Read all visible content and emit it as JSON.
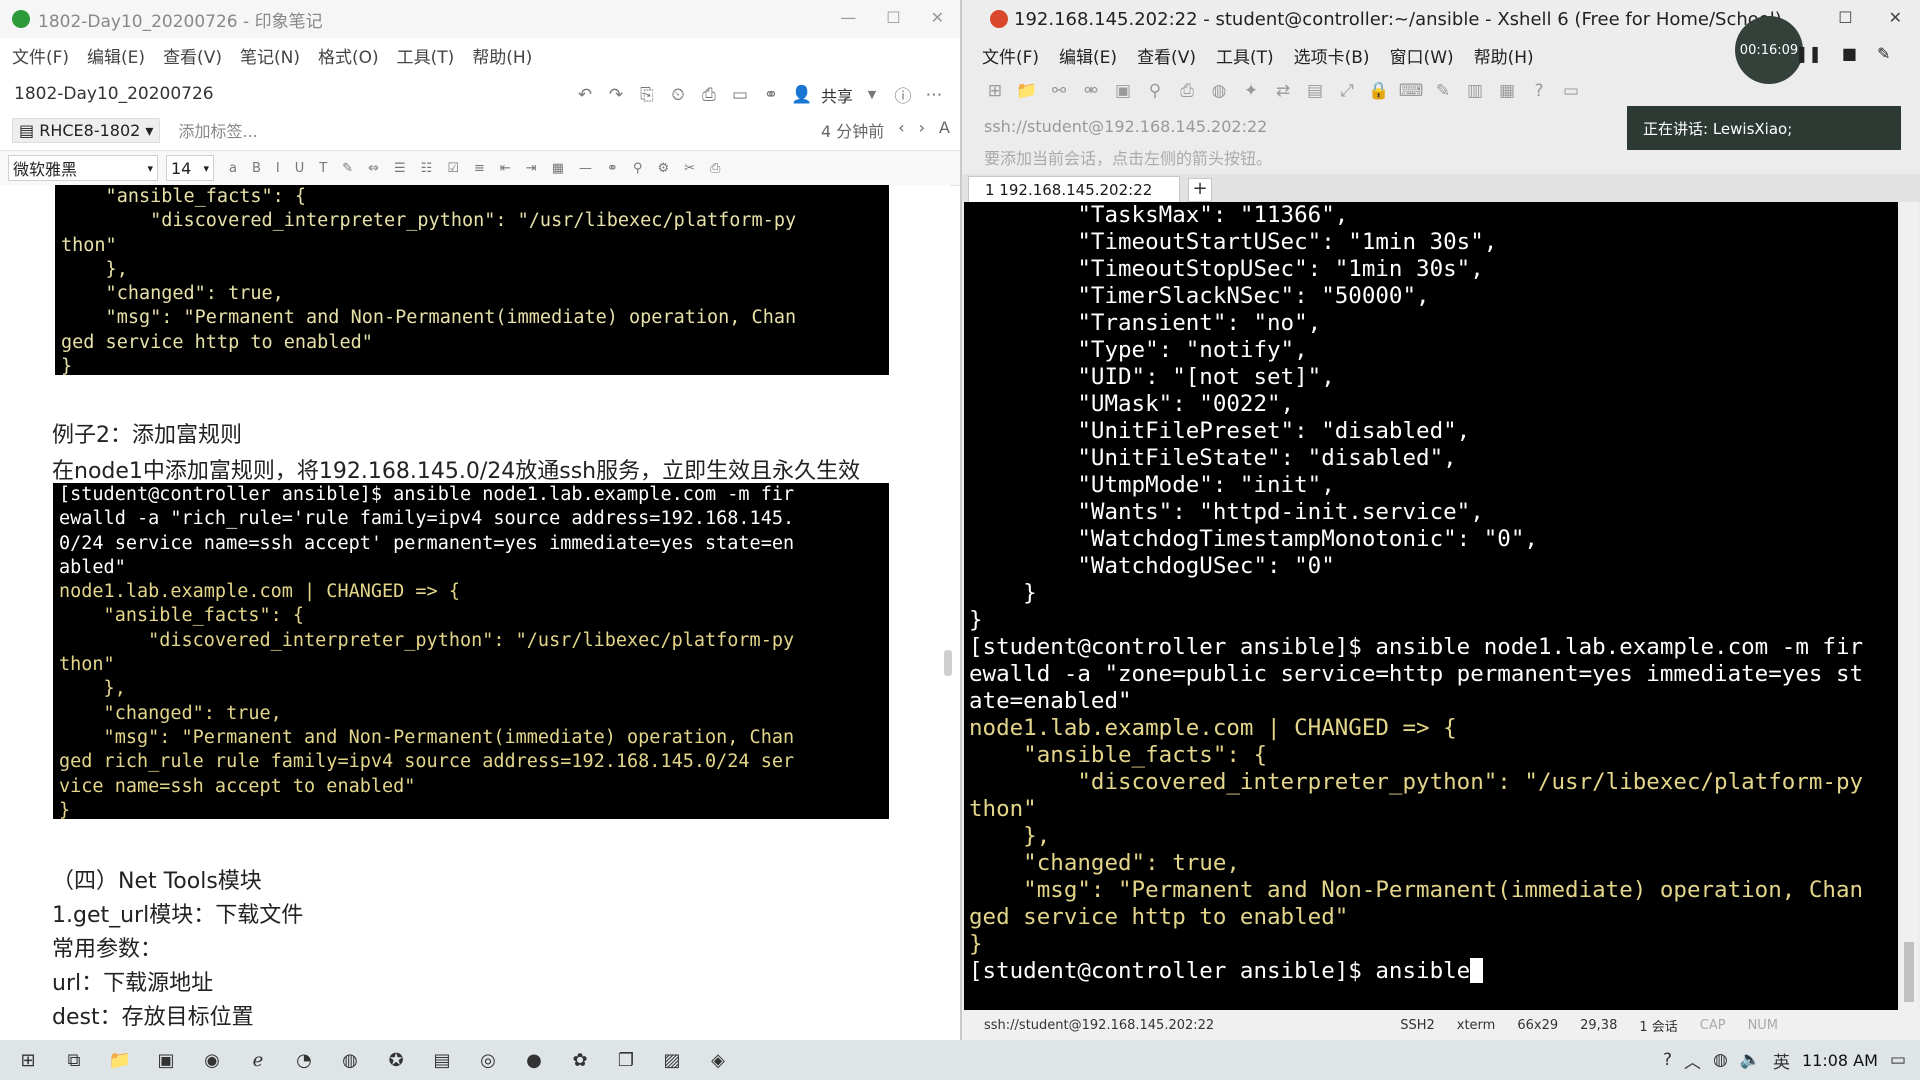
{
  "evernote": {
    "title": "1802-Day10_20200726 - 印象笔记",
    "window_controls": [
      "—",
      "☐",
      "✕"
    ],
    "menu": [
      "文件(F)",
      "编辑(E)",
      "查看(V)",
      "笔记(N)",
      "格式(O)",
      "工具(T)",
      "帮助(H)"
    ],
    "note_title": "1802-Day10_20200726",
    "share_label": "共享",
    "notebook_label": "RHCE8-1802",
    "add_tag_label": "添加标签...",
    "time_ago": "4 分钟前",
    "font_name": "微软雅黑",
    "font_size": "14",
    "format_icons": [
      "a",
      "B",
      "I",
      "U",
      "T",
      "✎",
      "⇔",
      "☰",
      "☷",
      "☑",
      "≡",
      "⇤",
      "⇥",
      "▦",
      "—",
      "⚭",
      "⚲",
      "⚙",
      "✂",
      "⎙"
    ],
    "code_block_1": [
      {
        "text": "    \"ansible_facts\": {",
        "color": "g"
      },
      {
        "text": "        \"discovered_interpreter_python\": \"/usr/libexec/platform-py",
        "color": "g"
      },
      {
        "text": "thon\"",
        "color": "g"
      },
      {
        "text": "    },",
        "color": "g"
      },
      {
        "text": "    \"changed\": true,",
        "color": "g"
      },
      {
        "text": "    \"msg\": \"Permanent and Non-Permanent(immediate) operation, Chan",
        "color": "g"
      },
      {
        "text": "ged service http to enabled\"",
        "color": "g"
      },
      {
        "text": "}",
        "color": "g"
      }
    ],
    "example2_title": "例子2：添加富规则",
    "example2_desc": "在node1中添加富规则，将192.168.145.0/24放通ssh服务，立即生效且永久生效",
    "code_block_2": [
      {
        "text": "[student@controller ansible]$ ansible node1.lab.example.com -m fir",
        "color": "w"
      },
      {
        "text": "ewalld -a \"rich_rule='rule family=ipv4 source address=192.168.145.",
        "color": "w"
      },
      {
        "text": "0/24 service name=ssh accept' permanent=yes immediate=yes state=en",
        "color": "w"
      },
      {
        "text": "abled\"",
        "color": "w"
      },
      {
        "text": "node1.lab.example.com | CHANGED => {",
        "color": "y"
      },
      {
        "text": "    \"ansible_facts\": {",
        "color": "y"
      },
      {
        "text": "        \"discovered_interpreter_python\": \"/usr/libexec/platform-py",
        "color": "y"
      },
      {
        "text": "thon\"",
        "color": "y"
      },
      {
        "text": "    },",
        "color": "y"
      },
      {
        "text": "    \"changed\": true,",
        "color": "y"
      },
      {
        "text": "    \"msg\": \"Permanent and Non-Permanent(immediate) operation, Chan",
        "color": "y"
      },
      {
        "text": "ged rich_rule rule family=ipv4 source address=192.168.145.0/24 ser",
        "color": "y"
      },
      {
        "text": "vice name=ssh accept to enabled\"",
        "color": "y"
      },
      {
        "text": "}",
        "color": "y"
      }
    ],
    "section_title": "（四）Net Tools模块",
    "get_url_title": "1.get_url模块：下载文件",
    "common_params": "常用参数：",
    "param_url": "url：下载源地址",
    "param_dest": "dest：存放目标位置"
  },
  "xshell": {
    "title": "192.168.145.202:22 - student@controller:~/ansible - Xshell 6 (Free for Home/School)",
    "window_controls": [
      "☐",
      "✕"
    ],
    "menu": [
      "文件(F)",
      "编辑(E)",
      "查看(V)",
      "工具(T)",
      "选项卡(B)",
      "窗口(W)",
      "帮助(H)"
    ],
    "address": "ssh://student@192.168.145.202:22",
    "hint": "要添加当前会话，点击左侧的箭头按钮。",
    "tab_label": "1 192.168.145.202:22",
    "tab_add": "+",
    "terminal_lines": [
      {
        "text": "        \"TasksMax\": \"11366\",",
        "color": "w"
      },
      {
        "text": "        \"TimeoutStartUSec\": \"1min 30s\",",
        "color": "w"
      },
      {
        "text": "        \"TimeoutStopUSec\": \"1min 30s\",",
        "color": "w"
      },
      {
        "text": "        \"TimerSlackNSec\": \"50000\",",
        "color": "w"
      },
      {
        "text": "        \"Transient\": \"no\",",
        "color": "w"
      },
      {
        "text": "        \"Type\": \"notify\",",
        "color": "w"
      },
      {
        "text": "        \"UID\": \"[not set]\",",
        "color": "w"
      },
      {
        "text": "        \"UMask\": \"0022\",",
        "color": "w"
      },
      {
        "text": "        \"UnitFilePreset\": \"disabled\",",
        "color": "w"
      },
      {
        "text": "        \"UnitFileState\": \"disabled\",",
        "color": "w"
      },
      {
        "text": "        \"UtmpMode\": \"init\",",
        "color": "w"
      },
      {
        "text": "        \"Wants\": \"httpd-init.service\",",
        "color": "w"
      },
      {
        "text": "        \"WatchdogTimestampMonotonic\": \"0\",",
        "color": "w"
      },
      {
        "text": "        \"WatchdogUSec\": \"0\"",
        "color": "w"
      },
      {
        "text": "    }",
        "color": "w"
      },
      {
        "text": "}",
        "color": "w"
      },
      {
        "text": "[student@controller ansible]$ ansible node1.lab.example.com -m fir",
        "color": "w"
      },
      {
        "text": "ewalld -a \"zone=public service=http permanent=yes immediate=yes st",
        "color": "w"
      },
      {
        "text": "ate=enabled\"",
        "color": "w"
      },
      {
        "text": "node1.lab.example.com | CHANGED => {",
        "color": "y"
      },
      {
        "text": "    \"ansible_facts\": {",
        "color": "y"
      },
      {
        "text": "        \"discovered_interpreter_python\": \"/usr/libexec/platform-py",
        "color": "y"
      },
      {
        "text": "thon\"",
        "color": "y"
      },
      {
        "text": "    },",
        "color": "y"
      },
      {
        "text": "    \"changed\": true,",
        "color": "y"
      },
      {
        "text": "    \"msg\": \"Permanent and Non-Permanent(immediate) operation, Chan",
        "color": "y"
      },
      {
        "text": "ged service http to enabled\"",
        "color": "y"
      },
      {
        "text": "}",
        "color": "y"
      }
    ],
    "prompt_line": "[student@controller ansible]$ ansible",
    "status": {
      "address": "ssh://student@192.168.145.202:22",
      "protocol": "SSH2",
      "terminal": "xterm",
      "size": "66x29",
      "position": "29,38",
      "sessions": "1 会话",
      "caps": "CAP",
      "num": "NUM"
    }
  },
  "recording": {
    "timer": "00:16:09",
    "speaker": "正在讲话: LewisXiao;"
  },
  "taskbar": {
    "clock": "11:08 AM",
    "ime": "英"
  },
  "colors": {
    "terminal_bg": "#000000",
    "output_yellow": "#e3d68a",
    "command_white": "#ffffff",
    "evernote_green": "#2d9b3a"
  }
}
